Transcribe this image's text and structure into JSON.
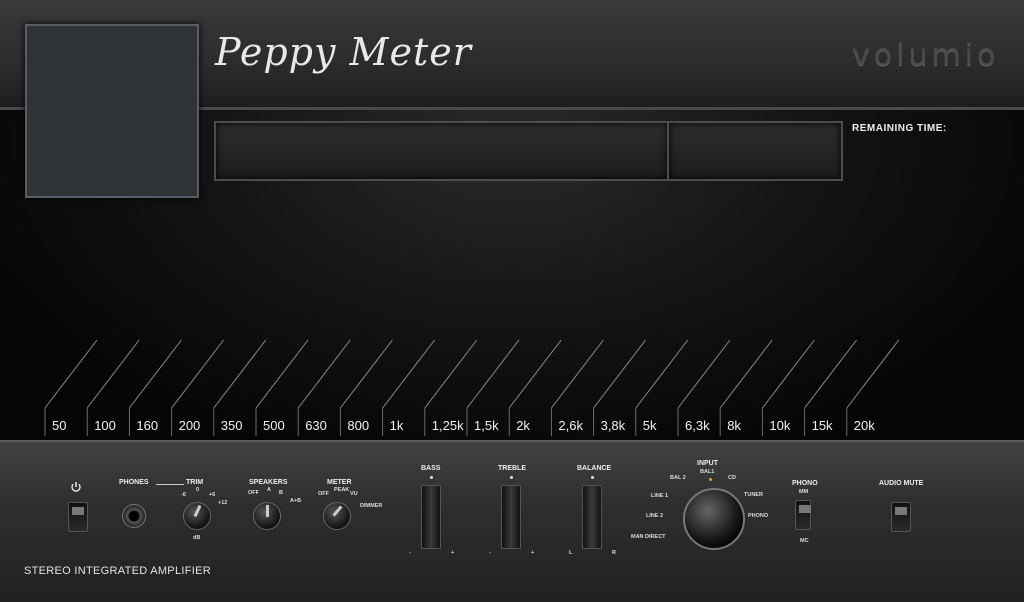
{
  "header": {
    "app_title": "Peppy Meter",
    "brand": "volumio"
  },
  "track": {
    "title": "",
    "remaining_label": "REMAINING TIME:"
  },
  "spectrum": {
    "bands": [
      "50",
      "100",
      "160",
      "200",
      "350",
      "500",
      "630",
      "800",
      "1k",
      "1,25k",
      "1,5k",
      "2k",
      "2,6k",
      "3,8k",
      "5k",
      "6,3k",
      "8k",
      "10k",
      "15k",
      "20k"
    ]
  },
  "controls": {
    "phones": "PHONES",
    "trim": {
      "label": "TRIM",
      "options": [
        "-6",
        "0",
        "+6",
        "+12"
      ],
      "unit": "dB"
    },
    "speakers": {
      "label": "SPEAKERS",
      "options": [
        "OFF",
        "A",
        "B",
        "A+B"
      ]
    },
    "meter": {
      "label": "METER",
      "options": [
        "OFF",
        "PEAK",
        "VU",
        "DIMMER"
      ]
    },
    "bass": {
      "label": "BASS",
      "minus": "-",
      "plus": "+"
    },
    "treble": {
      "label": "TREBLE",
      "minus": "-",
      "plus": "+"
    },
    "balance": {
      "label": "BALANCE",
      "left": "L",
      "right": "R"
    },
    "input": {
      "label": "INPUT",
      "options": [
        "BAL1",
        "BAL 2",
        "CD",
        "LINE 1",
        "TUNER",
        "LINE 2",
        "PHONO",
        "MAN DIRECT"
      ]
    },
    "phono": {
      "label": "PHONO",
      "mm": "MM",
      "mc": "MC"
    },
    "audio_mute": "AUDIO MUTE",
    "power_icon": "power-icon"
  },
  "footer": {
    "caption": "STEREO INTEGRATED AMPLIFIER"
  }
}
